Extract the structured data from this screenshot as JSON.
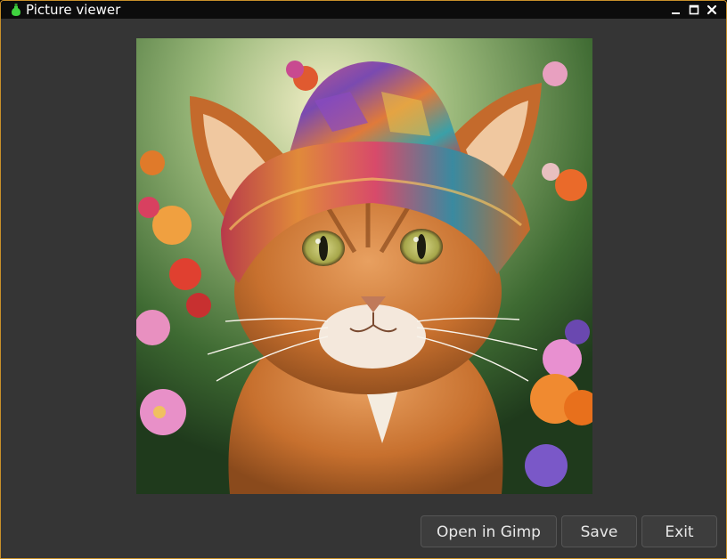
{
  "window": {
    "title": "Picture viewer",
    "border_color": "#c8902a",
    "titlebar_color": "#0c0c0c",
    "background_color": "#353535"
  },
  "titlebar_controls": {
    "minimize_icon": "minimize-icon",
    "maximize_icon": "maximize-icon",
    "close_icon": "close-icon"
  },
  "picture": {
    "subject": "orange tabby cat wearing a colorful patchwork hat among flowers"
  },
  "buttons": {
    "open_in_gimp": "Open in Gimp",
    "save": "Save",
    "exit": "Exit"
  }
}
